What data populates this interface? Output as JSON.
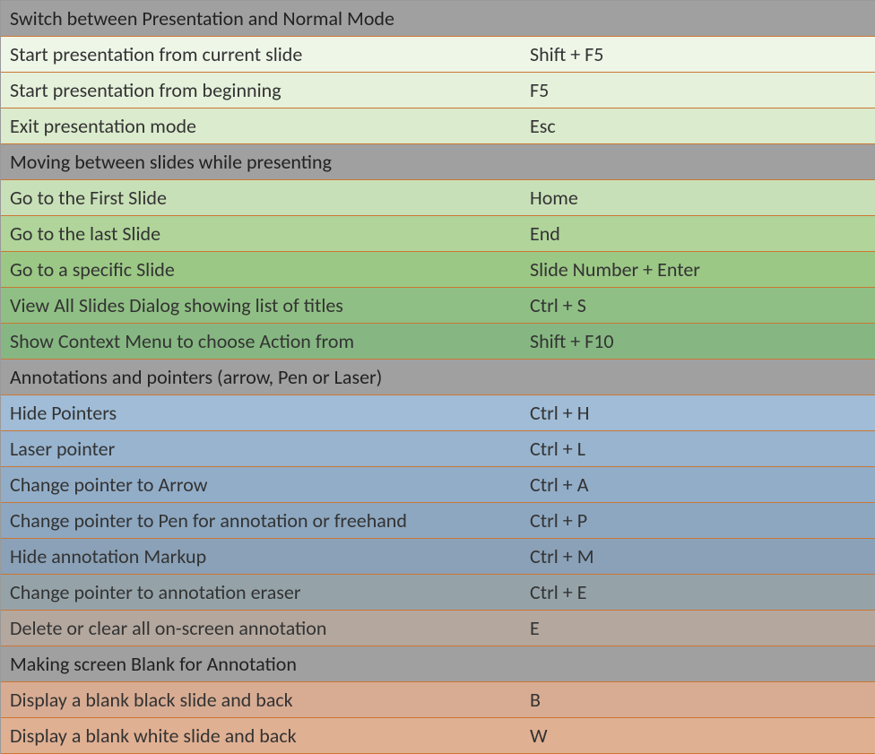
{
  "sections": [
    {
      "title": "Switch between Presentation and Normal Mode",
      "rowClassPrefix": "g1",
      "rows": [
        {
          "action": "Start presentation from current slide",
          "key": "Shift + F5"
        },
        {
          "action": "Start presentation from beginning",
          "key": "F5"
        },
        {
          "action": "Exit presentation mode",
          "key": "Esc"
        }
      ]
    },
    {
      "title": "Moving between slides while presenting",
      "rowClassPrefix": "g2",
      "rows": [
        {
          "action": "Go to the First Slide",
          "key": "Home"
        },
        {
          "action": "Go to the last Slide",
          "key": "End"
        },
        {
          "action": "Go to a specific Slide",
          "key": "Slide Number + Enter"
        },
        {
          "action": "View All Slides Dialog showing list of titles",
          "key": "Ctrl + S"
        },
        {
          "action": "Show Context Menu to choose Action from",
          "key": "Shift + F10"
        }
      ]
    },
    {
      "title": "Annotations and pointers (arrow, Pen or Laser)",
      "rowClassPrefix": "b",
      "rows": [
        {
          "action": "Hide Pointers",
          "key": "Ctrl + H"
        },
        {
          "action": "Laser pointer",
          "key": "Ctrl + L"
        },
        {
          "action": "Change pointer to Arrow",
          "key": "Ctrl + A"
        },
        {
          "action": "Change pointer to Pen for annotation or freehand",
          "key": "Ctrl +  P"
        },
        {
          "action": "Hide annotation Markup",
          "key": "Ctrl + M"
        },
        {
          "action": "Change pointer to annotation eraser",
          "key": "Ctrl + E"
        },
        {
          "action": "Delete or clear all on-screen annotation",
          "key": "E"
        }
      ]
    },
    {
      "title": "Making screen Blank for Annotation",
      "rowClassPrefix": "o",
      "rows": [
        {
          "action": "Display a blank black slide and back",
          "key": "B"
        },
        {
          "action": "Display a blank white slide and back",
          "key": "W"
        }
      ]
    }
  ]
}
